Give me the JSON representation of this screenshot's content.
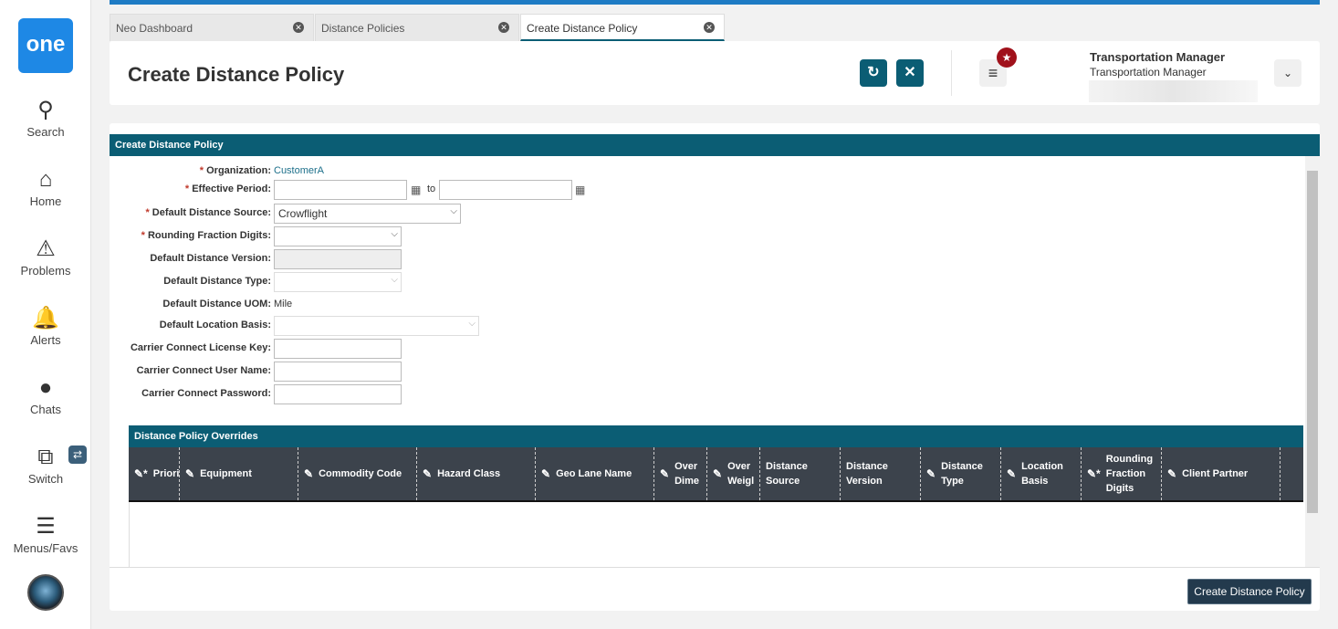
{
  "sidebar": {
    "logo": "one",
    "items": [
      {
        "label": "Search"
      },
      {
        "label": "Home"
      },
      {
        "label": "Problems"
      },
      {
        "label": "Alerts"
      },
      {
        "label": "Chats"
      },
      {
        "label": "Switch"
      },
      {
        "label": "Menus/Favs"
      }
    ]
  },
  "tabs": [
    {
      "label": "Neo Dashboard"
    },
    {
      "label": "Distance Policies"
    },
    {
      "label": "Create Distance Policy"
    }
  ],
  "header": {
    "title": "Create Distance Policy",
    "user_name": "Transportation Manager",
    "user_role": "Transportation Manager"
  },
  "panel": {
    "title": "Create Distance Policy"
  },
  "form": {
    "organization": {
      "label": "Organization:",
      "value": "CustomerA"
    },
    "effective_period": {
      "label": "Effective Period:",
      "from": "",
      "to_label": "to",
      "to": ""
    },
    "default_distance_source": {
      "label": "Default Distance Source:",
      "value": "Crowflight"
    },
    "rounding_fraction_digits": {
      "label": "Rounding Fraction Digits:",
      "value": ""
    },
    "default_distance_version": {
      "label": "Default Distance Version:",
      "value": ""
    },
    "default_distance_type": {
      "label": "Default Distance Type:",
      "value": ""
    },
    "default_distance_uom": {
      "label": "Default Distance UOM:",
      "value": "Mile"
    },
    "default_location_basis": {
      "label": "Default Location Basis:",
      "value": ""
    },
    "cc_license_key": {
      "label": "Carrier Connect License Key:",
      "value": ""
    },
    "cc_user_name": {
      "label": "Carrier Connect User Name:",
      "value": ""
    },
    "cc_password": {
      "label": "Carrier Connect Password:",
      "value": ""
    }
  },
  "overrides": {
    "title": "Distance Policy Overrides",
    "columns": [
      {
        "label": "Priori",
        "edit": true,
        "required": true
      },
      {
        "label": "Equipment",
        "edit": true
      },
      {
        "label": "Commodity Code",
        "edit": true
      },
      {
        "label": "Hazard Class",
        "edit": true
      },
      {
        "label": "Geo Lane Name",
        "edit": true
      },
      {
        "label": "Over Dime",
        "edit": true
      },
      {
        "label": "Over Weigl",
        "edit": true
      },
      {
        "label": "Distance Source",
        "edit": false
      },
      {
        "label": "Distance Version",
        "edit": false
      },
      {
        "label": "Distance Type",
        "edit": true
      },
      {
        "label": "Location Basis",
        "edit": true
      },
      {
        "label": "Rounding Fraction Digits",
        "edit": true,
        "required": true
      },
      {
        "label": "Client Partner",
        "edit": true
      }
    ]
  },
  "footer": {
    "create_label": "Create Distance Policy"
  },
  "colors": {
    "accent": "#0b5d74",
    "grid_header": "#3c434c",
    "badge": "#a0111b"
  }
}
